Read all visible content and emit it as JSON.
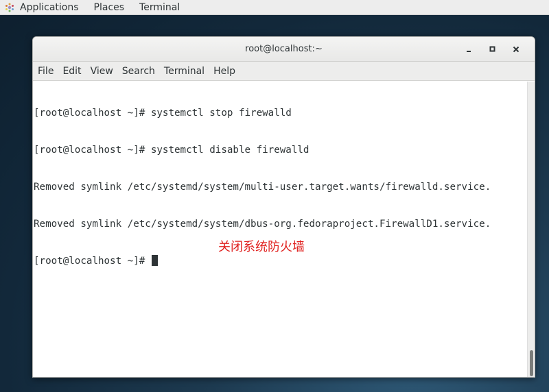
{
  "topbar": {
    "apps_icon": "gnome-foot-icon",
    "menus": [
      "Applications",
      "Places",
      "Terminal"
    ]
  },
  "window": {
    "title": "root@localhost:~",
    "buttons": {
      "minimize": "minimize-icon",
      "maximize": "maximize-icon",
      "close": "close-icon"
    },
    "menubar": [
      "File",
      "Edit",
      "View",
      "Search",
      "Terminal",
      "Help"
    ]
  },
  "terminal": {
    "lines": [
      "[root@localhost ~]# systemctl stop firewalld",
      "[root@localhost ~]# systemctl disable firewalld",
      "Removed symlink /etc/systemd/system/multi-user.target.wants/firewalld.service.",
      "Removed symlink /etc/systemd/system/dbus-org.fedoraproject.FirewallD1.service.",
      "[root@localhost ~]# "
    ]
  },
  "annotation": {
    "text": "关闭系统防火墙",
    "color": "#e0201e"
  }
}
